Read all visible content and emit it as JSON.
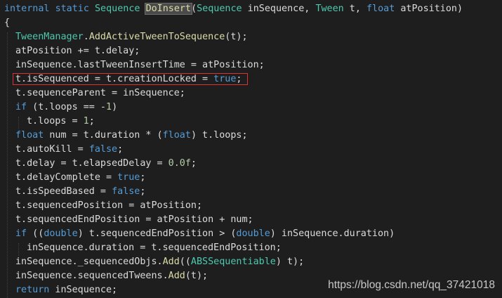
{
  "editor": {
    "colors": {
      "background": "#1e1e1e",
      "keyword": "#569cd6",
      "type": "#4ec9b0",
      "method": "#dcdcaa",
      "number": "#b5cea8",
      "plain": "#dcdcdc",
      "annotation_box": "#e03131"
    },
    "lines": [
      {
        "id": "l1",
        "indent": 0,
        "tokens": [
          {
            "t": "internal",
            "c": "kw"
          },
          {
            "t": " ",
            "c": "pl"
          },
          {
            "t": "static",
            "c": "kw"
          },
          {
            "t": " ",
            "c": "pl"
          },
          {
            "t": "Sequence",
            "c": "ty"
          },
          {
            "t": " ",
            "c": "pl"
          },
          {
            "t": "DoInsert",
            "c": "hl-method"
          },
          {
            "t": "(",
            "c": "pl"
          },
          {
            "t": "Sequence",
            "c": "ty"
          },
          {
            "t": " inSequence, ",
            "c": "pl"
          },
          {
            "t": "Tween",
            "c": "ty"
          },
          {
            "t": " t, ",
            "c": "pl"
          },
          {
            "t": "float",
            "c": "kw"
          },
          {
            "t": " atPosition)",
            "c": "pl"
          }
        ]
      },
      {
        "id": "l2",
        "indent": 0,
        "tokens": [
          {
            "t": "{",
            "c": "pl"
          }
        ]
      },
      {
        "id": "l3",
        "indent": 1,
        "tokens": [
          {
            "t": "TweenManager",
            "c": "ty"
          },
          {
            "t": ".",
            "c": "pl"
          },
          {
            "t": "AddActiveTweenToSequence",
            "c": "mt"
          },
          {
            "t": "(t);",
            "c": "pl"
          }
        ]
      },
      {
        "id": "l4",
        "indent": 1,
        "tokens": [
          {
            "t": "atPosition += t.delay;",
            "c": "pl"
          }
        ]
      },
      {
        "id": "l5",
        "indent": 1,
        "tokens": [
          {
            "t": "inSequence.lastTweenInsertTime = atPosition;",
            "c": "pl"
          }
        ]
      },
      {
        "id": "l6",
        "indent": 1,
        "tokens": [
          {
            "t": "t.isSequenced = t.creationLocked = ",
            "c": "pl"
          },
          {
            "t": "true",
            "c": "kw"
          },
          {
            "t": ";",
            "c": "pl"
          }
        ]
      },
      {
        "id": "l7",
        "indent": 1,
        "tokens": [
          {
            "t": "t.sequenceParent = inSequence;",
            "c": "pl"
          }
        ]
      },
      {
        "id": "l8",
        "indent": 1,
        "tokens": [
          {
            "t": "if",
            "c": "kw"
          },
          {
            "t": " (t.loops == -",
            "c": "pl"
          },
          {
            "t": "1",
            "c": "nm"
          },
          {
            "t": ")",
            "c": "pl"
          }
        ]
      },
      {
        "id": "l9",
        "indent": 2,
        "tokens": [
          {
            "t": "t.loops = ",
            "c": "pl"
          },
          {
            "t": "1",
            "c": "nm"
          },
          {
            "t": ";",
            "c": "pl"
          }
        ]
      },
      {
        "id": "l10",
        "indent": 1,
        "tokens": [
          {
            "t": "float",
            "c": "kw"
          },
          {
            "t": " num = t.duration * (",
            "c": "pl"
          },
          {
            "t": "float",
            "c": "kw"
          },
          {
            "t": ") t.loops;",
            "c": "pl"
          }
        ]
      },
      {
        "id": "l11",
        "indent": 1,
        "tokens": [
          {
            "t": "t.autoKill = ",
            "c": "pl"
          },
          {
            "t": "false",
            "c": "kw"
          },
          {
            "t": ";",
            "c": "pl"
          }
        ]
      },
      {
        "id": "l12",
        "indent": 1,
        "tokens": [
          {
            "t": "t.delay = t.elapsedDelay = ",
            "c": "pl"
          },
          {
            "t": "0.0f",
            "c": "nm"
          },
          {
            "t": ";",
            "c": "pl"
          }
        ]
      },
      {
        "id": "l13",
        "indent": 1,
        "tokens": [
          {
            "t": "t.delayComplete = ",
            "c": "pl"
          },
          {
            "t": "true",
            "c": "kw"
          },
          {
            "t": ";",
            "c": "pl"
          }
        ]
      },
      {
        "id": "l14",
        "indent": 1,
        "tokens": [
          {
            "t": "t.isSpeedBased = ",
            "c": "pl"
          },
          {
            "t": "false",
            "c": "kw"
          },
          {
            "t": ";",
            "c": "pl"
          }
        ]
      },
      {
        "id": "l15",
        "indent": 1,
        "tokens": [
          {
            "t": "t.sequencedPosition = atPosition;",
            "c": "pl"
          }
        ]
      },
      {
        "id": "l16",
        "indent": 1,
        "tokens": [
          {
            "t": "t.sequencedEndPosition = atPosition + num;",
            "c": "pl"
          }
        ]
      },
      {
        "id": "l17",
        "indent": 1,
        "tokens": [
          {
            "t": "if",
            "c": "kw"
          },
          {
            "t": " ((",
            "c": "pl"
          },
          {
            "t": "double",
            "c": "kw"
          },
          {
            "t": ") t.sequencedEndPosition > (",
            "c": "pl"
          },
          {
            "t": "double",
            "c": "kw"
          },
          {
            "t": ") inSequence.duration)",
            "c": "pl"
          }
        ]
      },
      {
        "id": "l18",
        "indent": 2,
        "tokens": [
          {
            "t": "inSequence.duration = t.sequencedEndPosition;",
            "c": "pl"
          }
        ]
      },
      {
        "id": "l19",
        "indent": 1,
        "tokens": [
          {
            "t": "inSequence._sequencedObjs.",
            "c": "pl"
          },
          {
            "t": "Add",
            "c": "mt"
          },
          {
            "t": "((",
            "c": "pl"
          },
          {
            "t": "ABSSequentiable",
            "c": "ty"
          },
          {
            "t": ") t);",
            "c": "pl"
          }
        ]
      },
      {
        "id": "l20",
        "indent": 1,
        "tokens": [
          {
            "t": "inSequence.sequencedTweens.",
            "c": "pl"
          },
          {
            "t": "Add",
            "c": "mt"
          },
          {
            "t": "(t);",
            "c": "pl"
          }
        ]
      },
      {
        "id": "l21",
        "indent": 1,
        "tokens": [
          {
            "t": "return",
            "c": "kw"
          },
          {
            "t": " inSequence;",
            "c": "pl"
          }
        ]
      }
    ]
  },
  "watermark": {
    "text": "https://blog.csdn.net/qq_37421018"
  }
}
